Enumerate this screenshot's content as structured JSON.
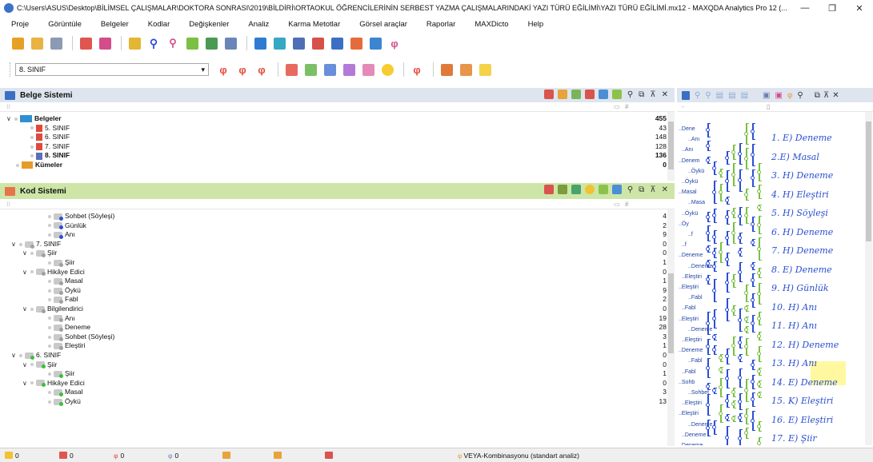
{
  "window": {
    "title": "C:\\Users\\ASUS\\Desktop\\BİLİMSEL ÇALIŞMALAR\\DOKTORA SONRASI\\2019\\BİLDİRİ\\ORTAOKUL ÖĞRENCİLERİNİN SERBEST YAZMA ÇALIŞMALARINDAKİ YAZI TÜRÜ EĞİLİMİ\\YAZI TÜRÜ EĞİLİMİ.mx12 - MAXQDA Analytics Pro 12 (...",
    "minimize": "—",
    "maximize": "❐",
    "close": "✕"
  },
  "menu": [
    "Proje",
    "Görüntüle",
    "Belgeler",
    "Kodlar",
    "Değişkenler",
    "Analiz",
    "Karma Metotlar",
    "Görsel araçlar",
    "Raporlar",
    "MAXDicto",
    "Help"
  ],
  "doc_select": {
    "value": "8. SINIF",
    "arrow": "▾"
  },
  "belge_panel": {
    "title": "Belge Sistemi",
    "root": {
      "label": "Belgeler",
      "count": "455"
    },
    "docs": [
      {
        "label": "5. SINIF",
        "count": "43",
        "active": false
      },
      {
        "label": "6. SINIF",
        "count": "148",
        "active": false
      },
      {
        "label": "7. SINIF",
        "count": "128",
        "active": false
      },
      {
        "label": "8. SINIF",
        "count": "136",
        "active": true
      }
    ],
    "sets": {
      "label": "Kümeler",
      "count": "0"
    }
  },
  "kod_panel": {
    "title": "Kod Sistemi",
    "rows": [
      {
        "indent": 3,
        "label": "Sohbet (Söyleşi)",
        "count": "4",
        "chev": "",
        "color": "#2c4fd6"
      },
      {
        "indent": 3,
        "label": "Günlük",
        "count": "2",
        "chev": "",
        "color": "#2c4fd6"
      },
      {
        "indent": 3,
        "label": "Anı",
        "count": "9",
        "chev": "",
        "color": "#2c4fd6"
      },
      {
        "indent": 1,
        "label": "7. SINIF",
        "count": "0",
        "chev": "∨",
        "color": "#a0a0a0"
      },
      {
        "indent": 2,
        "label": "Şiir",
        "count": "0",
        "chev": "∨",
        "color": "#a0a0a0"
      },
      {
        "indent": 3,
        "label": "Şiir",
        "count": "1",
        "chev": "",
        "color": "#a0a0a0"
      },
      {
        "indent": 2,
        "label": "Hikâye Edici",
        "count": "0",
        "chev": "∨",
        "color": "#a0a0a0"
      },
      {
        "indent": 3,
        "label": "Masal",
        "count": "1",
        "chev": "",
        "color": "#a0a0a0"
      },
      {
        "indent": 3,
        "label": "Öykü",
        "count": "9",
        "chev": "",
        "color": "#a0a0a0"
      },
      {
        "indent": 3,
        "label": "Fabl",
        "count": "2",
        "chev": "",
        "color": "#a0a0a0"
      },
      {
        "indent": 2,
        "label": "Bilgilendirici",
        "count": "0",
        "chev": "∨",
        "color": "#a0a0a0"
      },
      {
        "indent": 3,
        "label": "Anı",
        "count": "19",
        "chev": "",
        "color": "#a0a0a0"
      },
      {
        "indent": 3,
        "label": "Deneme",
        "count": "28",
        "chev": "",
        "color": "#a0a0a0"
      },
      {
        "indent": 3,
        "label": "Sohbet (Söyleşi)",
        "count": "3",
        "chev": "",
        "color": "#a0a0a0"
      },
      {
        "indent": 3,
        "label": "Eleştiri",
        "count": "1",
        "chev": "",
        "color": "#a0a0a0"
      },
      {
        "indent": 1,
        "label": "6. SINIF",
        "count": "0",
        "chev": "∨",
        "color": "#3cbf3c"
      },
      {
        "indent": 2,
        "label": "Şiir",
        "count": "0",
        "chev": "∨",
        "color": "#3cbf3c"
      },
      {
        "indent": 3,
        "label": "Şiir",
        "count": "1",
        "chev": "",
        "color": "#3cbf3c"
      },
      {
        "indent": 2,
        "label": "Hikâye Edici",
        "count": "0",
        "chev": "∨",
        "color": "#3cbf3c"
      },
      {
        "indent": 3,
        "label": "Masal",
        "count": "3",
        "chev": "",
        "color": "#3cbf3c"
      },
      {
        "indent": 3,
        "label": "Öykü",
        "count": "13",
        "chev": "",
        "color": "#3cbf3c"
      }
    ]
  },
  "column_labels": {
    "hash": "#"
  },
  "code_labels": [
    "..Dene",
    "..Anı",
    "..Anı",
    "..Denem",
    "..Öykü",
    "..Öykü",
    "..Masal",
    "..Masa",
    "..Öykü",
    "..Öy",
    "..f",
    "..f",
    "..Deneme",
    "..Deneme",
    "..Eleştiri",
    "..Eleştiri",
    "..Fabl",
    "..Fabl",
    "..Eleştiri",
    "..Deneme",
    "..Eleştiri",
    "..Deneme",
    "..Fabl",
    "..Fabl",
    "..Sohb",
    "..Sohbet",
    "..Eleştiri",
    "..Eleştiri",
    "..Deneme",
    "..Deneme",
    "..Deneme"
  ],
  "handwriting": [
    "1. E) Deneme",
    "2.E) Masal",
    "3. H) Deneme",
    "4. H) Eleştiri",
    "5. H) Söyleşi",
    "6. H) Deneme",
    "7. H) Deneme",
    "8. E) Deneme",
    "9. H) Günlük",
    "10. H) Anı",
    "11. H) Anı",
    "12. H) Deneme",
    "13. H) Anı",
    "14. E) Deneme",
    "15. K) Eleştiri",
    "16. E) Eleştiri",
    "17. E) Şiir"
  ],
  "status": {
    "docs": "0",
    "codes": "0",
    "retrieved": "0",
    "vars": "0",
    "analysis": "VEYA-Kombinasyonu (standart analiz)"
  },
  "colors": {
    "belge_head": "#dfe5ee",
    "kod_head": "#cde6a8",
    "accent_blue": "#2c4fd6",
    "accent_green": "#3cbf3c",
    "handwriting": "#2b4fd0"
  }
}
